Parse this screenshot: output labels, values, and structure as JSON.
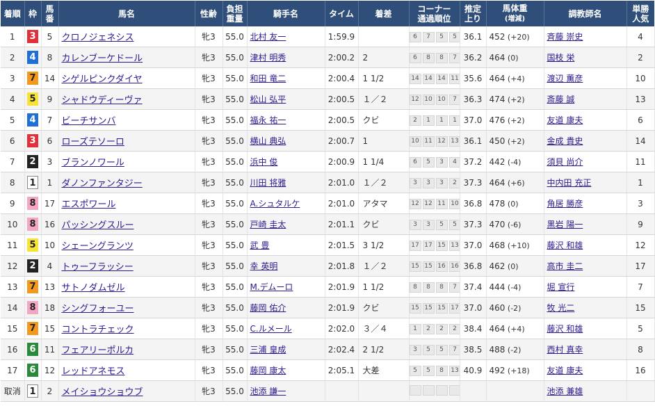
{
  "headers": {
    "pos": "着順",
    "waku": "枠",
    "num_a": "馬",
    "num_b": "番",
    "horse": "馬名",
    "sexage": "性齢",
    "weight_a": "負担",
    "weight_b": "重量",
    "jockey": "騎手名",
    "time": "タイム",
    "margin": "着差",
    "corner_a": "コーナー",
    "corner_b": "通過順位",
    "last3f_a": "推定",
    "last3f_b": "上り",
    "bodyweight_a": "馬体重",
    "bodyweight_b": "(増減)",
    "trainer": "調教師名",
    "pop_a": "単勝",
    "pop_b": "人気"
  },
  "rows": [
    {
      "pos": "1",
      "waku": "3",
      "num": "5",
      "horse": "クロノジェネシス",
      "sexage": "牝3",
      "weight": "55.0",
      "jockey": "北村 友一",
      "time": "1:59.9",
      "margin": "",
      "corners": [
        "6",
        "7",
        "5",
        "5"
      ],
      "last3f": "36.1",
      "bodyweight": "452",
      "bwdiff": "(+20)",
      "trainer": "斉藤 崇史",
      "pop": "4"
    },
    {
      "pos": "2",
      "waku": "4",
      "num": "8",
      "horse": "カレンブーケドール",
      "sexage": "牝3",
      "weight": "55.0",
      "jockey": "津村 明秀",
      "time": "2:00.2",
      "margin": "2",
      "corners": [
        "6",
        "8",
        "8",
        "7"
      ],
      "last3f": "36.2",
      "bodyweight": "464",
      "bwdiff": "(0)",
      "trainer": "国枝 栄",
      "pop": "2"
    },
    {
      "pos": "3",
      "waku": "7",
      "num": "14",
      "horse": "シゲルピンクダイヤ",
      "sexage": "牝3",
      "weight": "55.0",
      "jockey": "和田 竜二",
      "time": "2:00.4",
      "margin": "1 1/2",
      "corners": [
        "14",
        "14",
        "14",
        "11"
      ],
      "last3f": "35.6",
      "bodyweight": "464",
      "bwdiff": "(+4)",
      "trainer": "渡辺 薫彦",
      "pop": "10"
    },
    {
      "pos": "4",
      "waku": "5",
      "num": "9",
      "horse": "シャドウディーヴァ",
      "sexage": "牝3",
      "weight": "55.0",
      "jockey": "松山 弘平",
      "time": "2:00.5",
      "margin": "１／２",
      "corners": [
        "12",
        "10",
        "10",
        "7"
      ],
      "last3f": "36.3",
      "bodyweight": "474",
      "bwdiff": "(+2)",
      "trainer": "斎藤 誠",
      "pop": "13"
    },
    {
      "pos": "5",
      "waku": "4",
      "num": "7",
      "horse": "ビーチサンバ",
      "sexage": "牝3",
      "weight": "55.0",
      "jockey": "福永 祐一",
      "time": "2:00.5",
      "margin": "クビ",
      "corners": [
        "2",
        "1",
        "1",
        "1"
      ],
      "last3f": "37.0",
      "bodyweight": "476",
      "bwdiff": "(+2)",
      "trainer": "友道 康夫",
      "pop": "6"
    },
    {
      "pos": "6",
      "waku": "3",
      "num": "6",
      "horse": "ローズテソーロ",
      "sexage": "牝3",
      "weight": "55.0",
      "jockey": "横山 典弘",
      "time": "2:00.7",
      "margin": "1",
      "corners": [
        "10",
        "11",
        "12",
        "13"
      ],
      "last3f": "36.1",
      "bodyweight": "450",
      "bwdiff": "(+2)",
      "trainer": "金成 貴史",
      "pop": "14"
    },
    {
      "pos": "7",
      "waku": "2",
      "num": "3",
      "horse": "ブランノワール",
      "sexage": "牝3",
      "weight": "55.0",
      "jockey": "浜中 俊",
      "time": "2:00.9",
      "margin": "1 1/4",
      "corners": [
        "6",
        "5",
        "3",
        "4"
      ],
      "last3f": "37.2",
      "bodyweight": "442",
      "bwdiff": "(-4)",
      "trainer": "須貝 尚介",
      "pop": "11"
    },
    {
      "pos": "8",
      "waku": "1",
      "num": "1",
      "horse": "ダノンファンタジー",
      "sexage": "牝3",
      "weight": "55.0",
      "jockey": "川田 将雅",
      "time": "2:01.0",
      "margin": "１／２",
      "corners": [
        "3",
        "3",
        "3",
        "2"
      ],
      "last3f": "37.3",
      "bodyweight": "464",
      "bwdiff": "(+6)",
      "trainer": "中内田 充正",
      "pop": "1"
    },
    {
      "pos": "9",
      "waku": "8",
      "num": "17",
      "horse": "エスポワール",
      "sexage": "牝3",
      "weight": "55.0",
      "jockey": "A.シュタルケ",
      "time": "2:01.0",
      "margin": "アタマ",
      "corners": [
        "12",
        "12",
        "11",
        "10"
      ],
      "last3f": "36.8",
      "bodyweight": "478",
      "bwdiff": "(0)",
      "trainer": "角居 勝彦",
      "pop": "3"
    },
    {
      "pos": "10",
      "waku": "8",
      "num": "16",
      "horse": "パッシングスルー",
      "sexage": "牝3",
      "weight": "55.0",
      "jockey": "戸崎 圭太",
      "time": "2:01.1",
      "margin": "クビ",
      "corners": [
        "3",
        "3",
        "5",
        "5"
      ],
      "last3f": "37.3",
      "bodyweight": "470",
      "bwdiff": "(-6)",
      "trainer": "黒岩 陽一",
      "pop": "9"
    },
    {
      "pos": "11",
      "waku": "5",
      "num": "10",
      "horse": "シェーングランツ",
      "sexage": "牝3",
      "weight": "55.0",
      "jockey": "武 豊",
      "time": "2:01.5",
      "margin": "3 1/2",
      "corners": [
        "17",
        "17",
        "15",
        "13"
      ],
      "last3f": "37.0",
      "bodyweight": "468",
      "bwdiff": "(+10)",
      "trainer": "藤沢 和雄",
      "pop": "12"
    },
    {
      "pos": "12",
      "waku": "2",
      "num": "4",
      "horse": "トゥーフラッシー",
      "sexage": "牝3",
      "weight": "55.0",
      "jockey": "幸 英明",
      "time": "2:01.8",
      "margin": "１／２",
      "corners": [
        "15",
        "15",
        "16",
        "16"
      ],
      "last3f": "36.8",
      "bodyweight": "462",
      "bwdiff": "(0)",
      "trainer": "高市 圭二",
      "pop": "17"
    },
    {
      "pos": "13",
      "waku": "7",
      "num": "13",
      "horse": "サトノダムゼル",
      "sexage": "牝3",
      "weight": "55.0",
      "jockey": "M.デムーロ",
      "time": "2:01.9",
      "margin": "1 1/2",
      "corners": [
        "8",
        "8",
        "8",
        "7"
      ],
      "last3f": "37.4",
      "bodyweight": "444",
      "bwdiff": "(-4)",
      "trainer": "堀 宣行",
      "pop": "7"
    },
    {
      "pos": "14",
      "waku": "8",
      "num": "18",
      "horse": "シングフォーユー",
      "sexage": "牝3",
      "weight": "55.0",
      "jockey": "藤岡 佑介",
      "time": "2:01.9",
      "margin": "クビ",
      "corners": [
        "15",
        "15",
        "15",
        "17"
      ],
      "last3f": "37.0",
      "bodyweight": "460",
      "bwdiff": "(-2)",
      "trainer": "牧 光二",
      "pop": "15"
    },
    {
      "pos": "15",
      "waku": "7",
      "num": "15",
      "horse": "コントラチェック",
      "sexage": "牝3",
      "weight": "55.0",
      "jockey": "C.ルメール",
      "time": "2:02.0",
      "margin": "３／４",
      "corners": [
        "1",
        "2",
        "2",
        "2"
      ],
      "last3f": "38.4",
      "bodyweight": "464",
      "bwdiff": "(+4)",
      "trainer": "藤沢 和雄",
      "pop": "5"
    },
    {
      "pos": "16",
      "waku": "6",
      "num": "11",
      "horse": "フェアリーポルカ",
      "sexage": "牝3",
      "weight": "55.0",
      "jockey": "三浦 皇成",
      "time": "2:02.4",
      "margin": "2 1/2",
      "corners": [
        "3",
        "5",
        "5",
        "7"
      ],
      "last3f": "38.5",
      "bodyweight": "488",
      "bwdiff": "(-2)",
      "trainer": "西村 真幸",
      "pop": "8"
    },
    {
      "pos": "17",
      "waku": "6",
      "num": "12",
      "horse": "レッドアネモス",
      "sexage": "牝3",
      "weight": "55.0",
      "jockey": "藤岡 康太",
      "time": "2:05.1",
      "margin": "大差",
      "corners": [
        "5",
        "5",
        "8",
        "13"
      ],
      "last3f": "40.9",
      "bodyweight": "492",
      "bwdiff": "(+18)",
      "trainer": "友道 康夫",
      "pop": "16"
    },
    {
      "pos": "取消",
      "waku": "1",
      "num": "2",
      "horse": "メイショウショウブ",
      "sexage": "牝3",
      "weight": "55.0",
      "jockey": "池添 謙一",
      "time": "",
      "margin": "",
      "corners": [],
      "last3f": "",
      "bodyweight": "",
      "bwdiff": "",
      "trainer": "池添 兼雄",
      "pop": ""
    }
  ]
}
